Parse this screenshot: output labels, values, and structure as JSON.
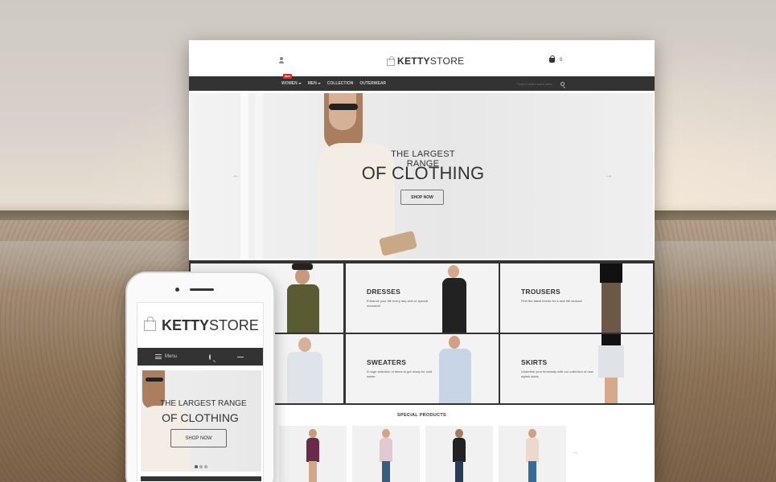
{
  "desktop": {
    "logo": {
      "part1": "KETTY",
      "part2": "STORE"
    },
    "cart_count": "0",
    "nav": {
      "items": [
        "WOMEN",
        "MEN",
        "COLLECTION",
        "OUTERWEAR"
      ],
      "new_badge": "NEW",
      "search_placeholder": "Search entire store here..."
    },
    "hero": {
      "line1": "THE LARGEST RANGE",
      "line2": "OF CLOTHING",
      "button": "SHOP NOW",
      "prev_arrow": "←",
      "next_arrow": "→"
    },
    "categories": [
      {
        "title": "DRESSES",
        "desc": "Enhance your life every day and on special occasion!"
      },
      {
        "title": "TROUSERS",
        "desc": "Find the latest trends for a new fall season!"
      },
      {
        "title": "SWEATERS",
        "desc": "A huge selection of items to get ready for cold winter."
      },
      {
        "title": "SKIRTS",
        "desc": "Underline your femininity with our collection of new stylish skirts."
      }
    ],
    "special_products_title": "SPECIAL PRODUCTS",
    "products_next_arrow": "→"
  },
  "mobile": {
    "logo": {
      "part1": "KETTY",
      "part2": "STORE"
    },
    "menu_label": "Menu",
    "cart_count": "0",
    "hero": {
      "line1": "THE LARGEST RANGE",
      "line2": "OF CLOTHING",
      "button": "SHOP NOW"
    }
  },
  "colors": {
    "nav_dark": "#333333",
    "sale_badge": "#e02b2b",
    "text": "#333333",
    "panel_bg": "#f3f3f3"
  }
}
